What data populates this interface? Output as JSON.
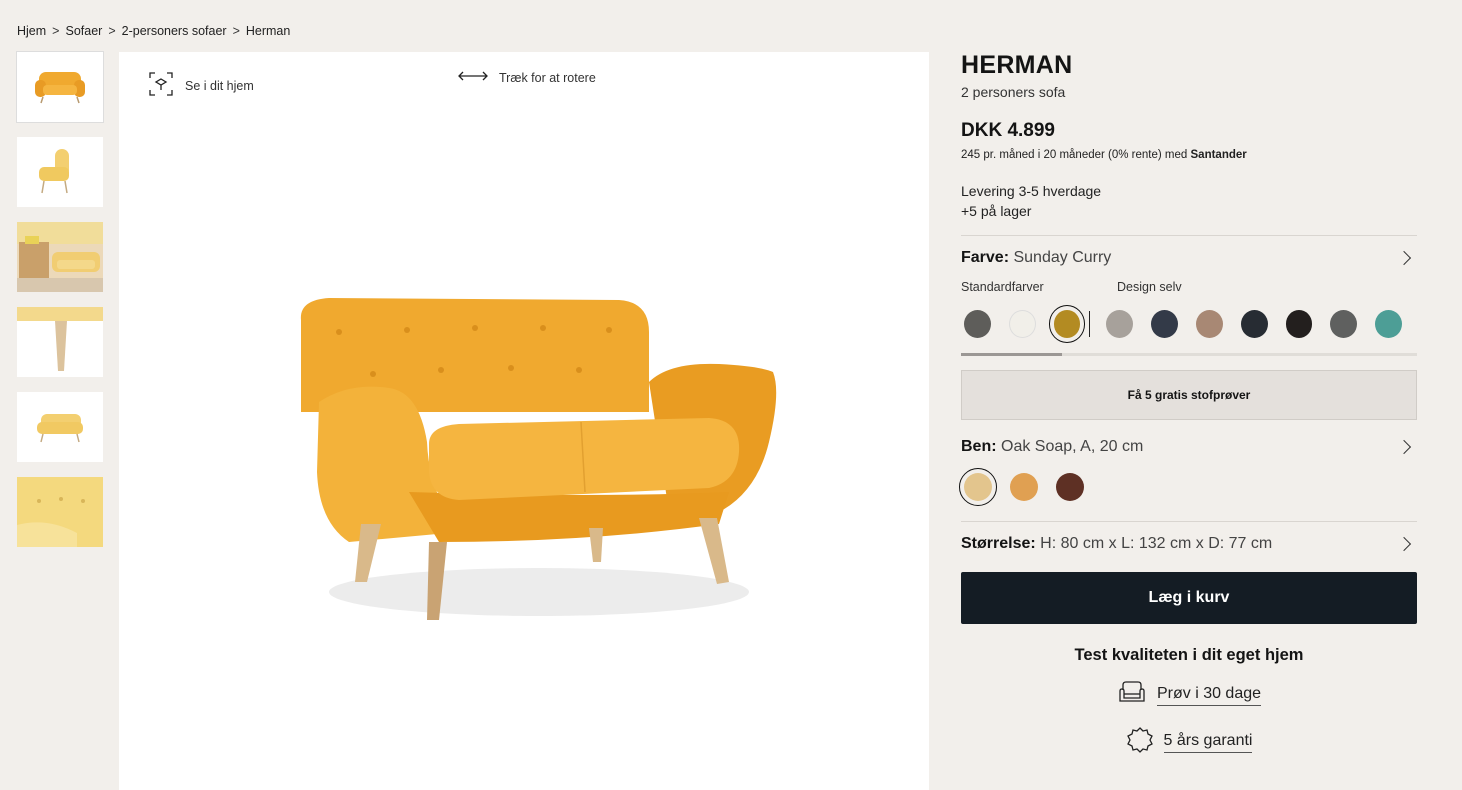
{
  "breadcrumb": {
    "items": [
      "Hjem",
      "Sofaer",
      "2-personers sofaer",
      "Herman"
    ],
    "separator": ">"
  },
  "viewer": {
    "ar_label": "Se i dit hjem",
    "rotate_label": "Træk for at rotere"
  },
  "product": {
    "title": "HERMAN",
    "subtitle": "2 personers sofa",
    "price": "DKK 4.899",
    "financing_text": "245 pr. måned i 20 måneder (0% rente) med",
    "financing_partner": "Santander",
    "delivery": "Levering 3-5 hverdage",
    "stock": "+5 på lager"
  },
  "color_option": {
    "label": "Farve:",
    "value": "Sunday Curry",
    "group_standard": "Standardfarver",
    "group_custom": "Design selv",
    "standard_swatches": [
      "#5e5d5a",
      "#f1efe9",
      "#b38b22"
    ],
    "custom_swatches": [
      "#a7a19b",
      "#333a48",
      "#a88874",
      "#272c33",
      "#231f1e",
      "#5f605f",
      "#4d9e96"
    ],
    "samples_button": "Få 5 gratis stofprøver"
  },
  "legs_option": {
    "label": "Ben:",
    "value": "Oak Soap, A, 20 cm",
    "swatches": [
      "#e3c58d",
      "#e0a052",
      "#5e3024"
    ]
  },
  "size_option": {
    "label": "Størrelse:",
    "value": "H: 80 cm x L: 132 cm x D: 77 cm"
  },
  "cart_button": "Læg i kurv",
  "quality": {
    "heading": "Test kvaliteten i dit eget hjem",
    "trial": "Prøv i 30 dage",
    "warranty": "5 års garanti"
  },
  "colors": {
    "sofa": "#f0a92f",
    "sofa_dark": "#d98f1c",
    "background": "#f2efeb",
    "cart_button": "#141c24"
  }
}
